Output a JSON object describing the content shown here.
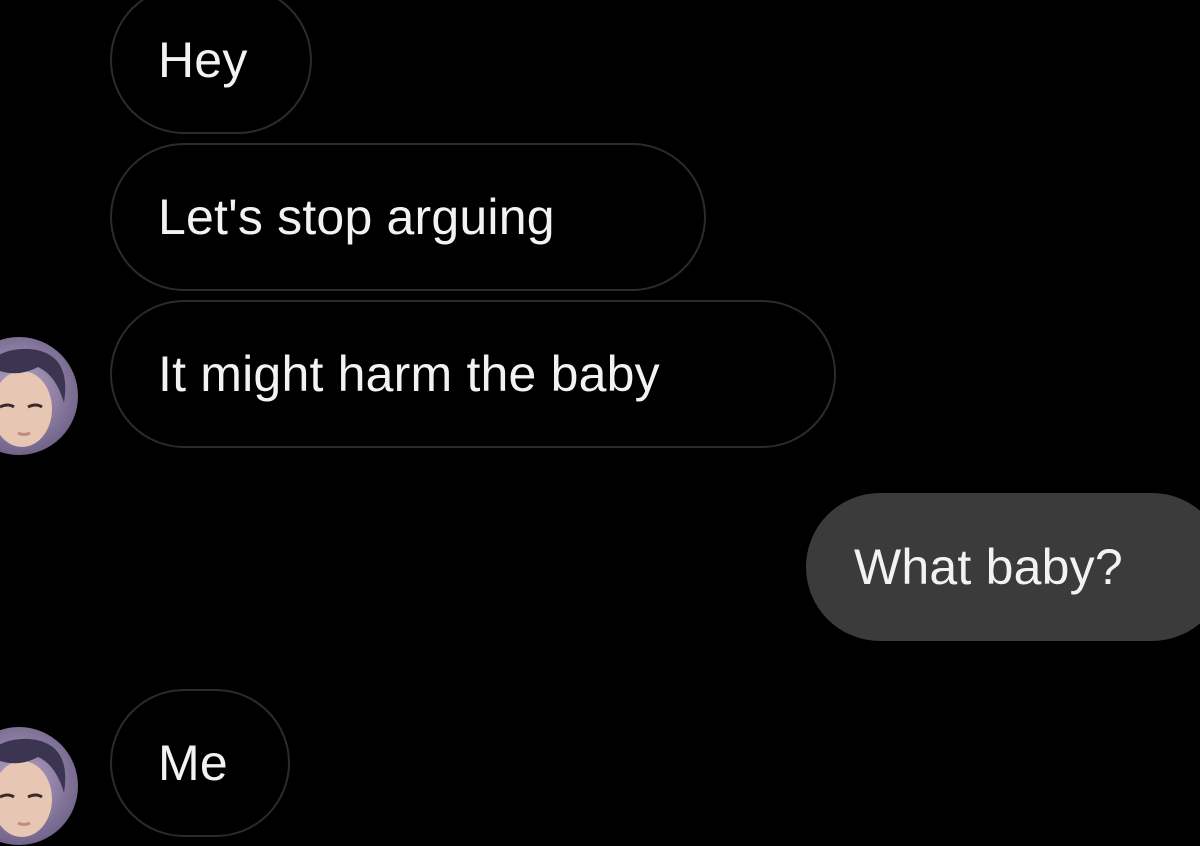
{
  "conversation": {
    "messages": [
      {
        "sender": "contact",
        "text": "Hey"
      },
      {
        "sender": "contact",
        "text": "Let's stop arguing"
      },
      {
        "sender": "contact",
        "text": "It might harm the baby"
      },
      {
        "sender": "me",
        "text": "What baby?"
      },
      {
        "sender": "contact",
        "text": "Me"
      }
    ]
  },
  "theme": {
    "background": "#000000",
    "incoming_bubble_border": "#2b2b2b",
    "outgoing_bubble_fill": "#3b3b3b",
    "text_color": "#f2f2f2"
  },
  "icons": {
    "contact_avatar": "contact-avatar-icon"
  }
}
